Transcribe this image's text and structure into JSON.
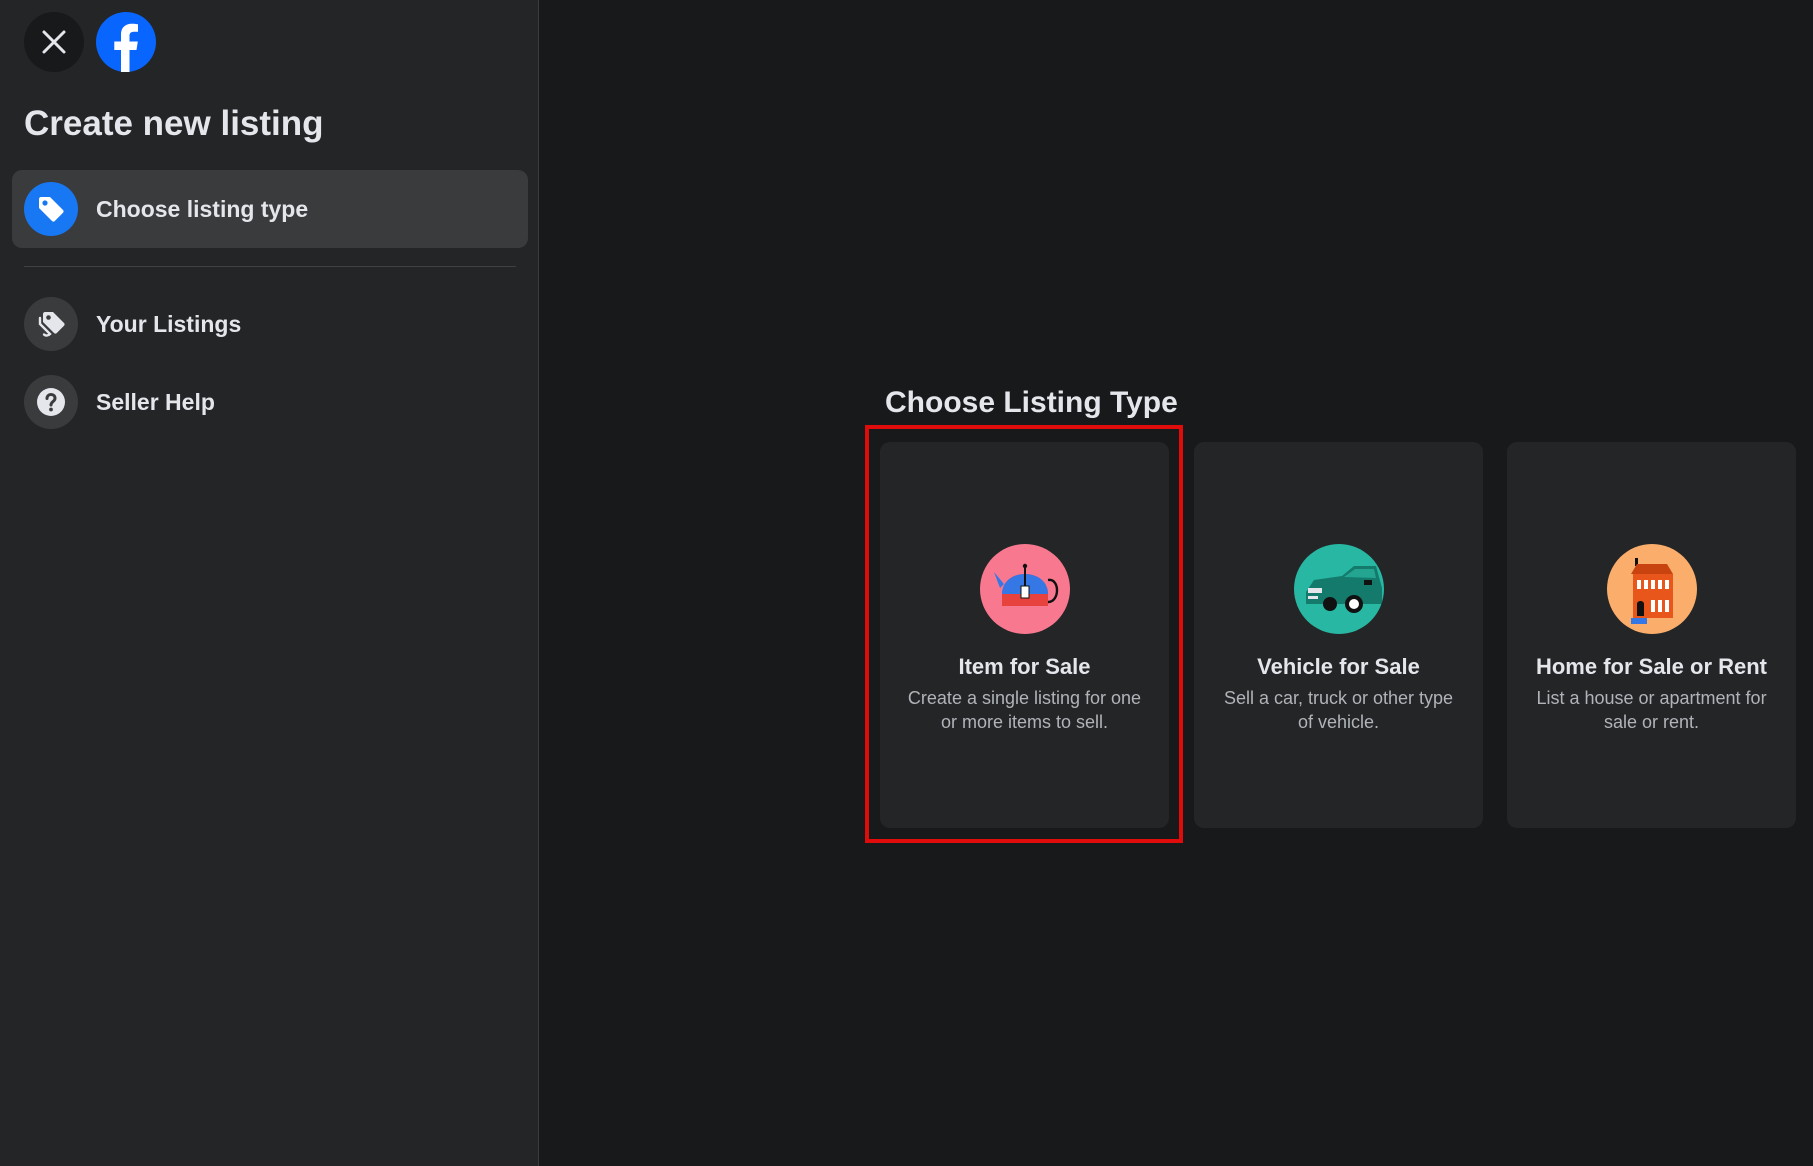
{
  "sidebar": {
    "title": "Create new listing",
    "items": [
      {
        "label": "Choose listing type",
        "icon": "tag-icon",
        "active": true
      },
      {
        "label": "Your Listings",
        "icon": "tags-icon",
        "active": false
      },
      {
        "label": "Seller Help",
        "icon": "help-icon",
        "active": false
      }
    ]
  },
  "main": {
    "title": "Choose Listing Type",
    "cards": [
      {
        "title": "Item for Sale",
        "description": "Create a single listing for one or more items to sell.",
        "icon": "item-for-sale-icon",
        "icon_bg": "#f8798f",
        "selected": true
      },
      {
        "title": "Vehicle for Sale",
        "description": "Sell a car, truck or other type of vehicle.",
        "icon": "vehicle-icon",
        "icon_bg": "#27b7a3",
        "selected": false
      },
      {
        "title": "Home for Sale or Rent",
        "description": "List a house or apartment for sale or rent.",
        "icon": "house-icon",
        "icon_bg": "#fbae6b",
        "selected": false
      }
    ]
  },
  "colors": {
    "accent": "#1877f2",
    "highlight": "#e00b0b",
    "sidebar_bg": "#242526",
    "page_bg": "#18191a"
  }
}
